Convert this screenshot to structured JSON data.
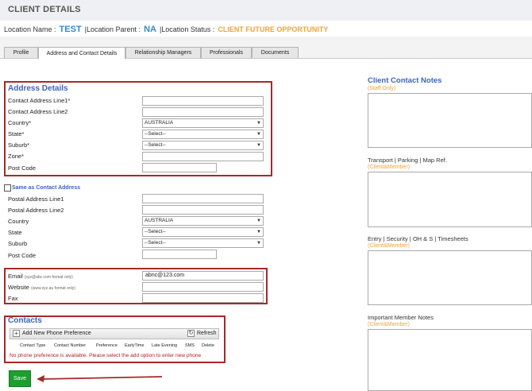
{
  "page_title": "CLIENT DETAILS",
  "location": {
    "name_label": "Location Name :",
    "name_value": "TEST",
    "parent_label": "|Location Parent :",
    "parent_value": "NA",
    "status_label": "|Location Status :",
    "status_value": "CLIENT FUTURE OPPORTUNITY"
  },
  "tabs": [
    {
      "label": "Profile"
    },
    {
      "label": "Address and Contact Details"
    },
    {
      "label": "Relationship Managers"
    },
    {
      "label": "Professionals"
    },
    {
      "label": "Documents"
    }
  ],
  "address": {
    "title": "Address Details",
    "line1_label": "Contact Address Line1*",
    "line2_label": "Contact Address Line2",
    "country_label": "Country*",
    "country_value": "AUSTRALIA",
    "state_label": "State*",
    "state_value": "--Select--",
    "suburb_label": "Suburb*",
    "suburb_value": "--Select--",
    "zone_label": "Zone*",
    "postcode_label": "Post Code"
  },
  "postal": {
    "same_label": "Same as Contact Address",
    "line1_label": "Postal Address Line1",
    "line2_label": "Postal Address Line2",
    "country_label": "Country",
    "country_value": "AUSTRALIA",
    "state_label": "State",
    "state_value": "--Select--",
    "suburb_label": "Suburb",
    "suburb_value": "--Select--",
    "postcode_label": "Post Code"
  },
  "contact": {
    "email_label": "Email",
    "email_hint": "(xyz@abc.com format only)",
    "email_value": "abnc@123.com",
    "website_label": "Website",
    "website_hint": "(www.xyz.au format only)",
    "fax_label": "Fax"
  },
  "contacts": {
    "title": "Contacts",
    "add_label": "Add New Phone Preference",
    "refresh_label": "Refresh",
    "columns": [
      "Contact Type",
      "Contact Number",
      "Preference",
      "EarlyTime",
      "Late Evening",
      "SMS",
      "Delete"
    ],
    "empty_message": "No phone preference is available. Please select the add option to enter new phone"
  },
  "save_label": "Save",
  "notes": {
    "client_title": "Client Contact Notes",
    "client_sub": "(Staff Only)",
    "transport_title": "Transport | Parking | Map Ref.",
    "transport_sub": "(Client&Member)",
    "entry_title": "Entry | Security | OH & S | Timesheets",
    "entry_sub": "(Client&Member)",
    "important_title": "Important Member Notes",
    "important_sub": "(Client&Member)"
  },
  "colors": {
    "accent_blue": "#3a64c2",
    "orange": "#f3a33a",
    "highlight_red": "#a52a2a",
    "save_green": "#1e9e2e"
  }
}
